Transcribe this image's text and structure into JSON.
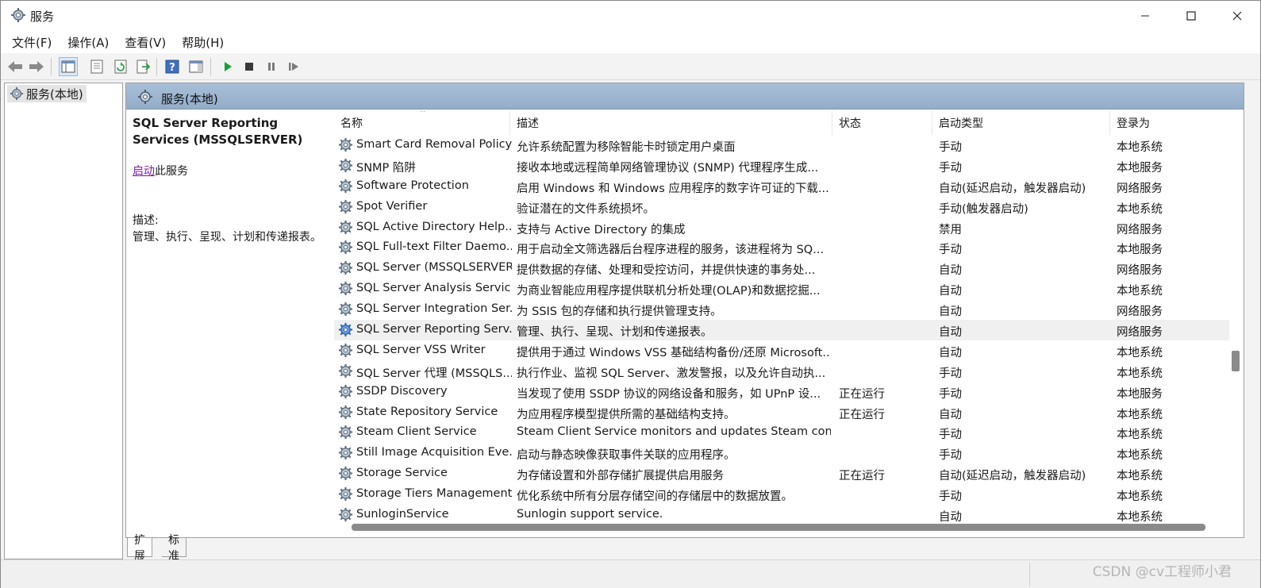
{
  "window": {
    "title": "服务",
    "menu": [
      "文件(F)",
      "操作(A)",
      "查看(V)",
      "帮助(H)"
    ]
  },
  "tree": {
    "root_label": "服务(本地)"
  },
  "main": {
    "header": "服务(本地)",
    "detail": {
      "title": "SQL Server Reporting Services (MSSQLSERVER)",
      "start_link": "启动",
      "start_suffix": "此服务",
      "desc_label": "描述:",
      "desc": "管理、执行、呈现、计划和传递报表。"
    },
    "columns": {
      "name": "名称",
      "desc": "描述",
      "status": "状态",
      "startup": "启动类型",
      "logon": "登录为"
    },
    "rows": [
      {
        "name": "Smart Card Removal Policy",
        "desc": "允许系统配置为移除智能卡时锁定用户桌面",
        "status": "",
        "startup": "手动",
        "logon": "本地系统"
      },
      {
        "name": "SNMP 陷阱",
        "desc": "接收本地或远程简单网络管理协议 (SNMP) 代理程序生成...",
        "status": "",
        "startup": "手动",
        "logon": "本地服务"
      },
      {
        "name": "Software Protection",
        "desc": "启用 Windows 和 Windows 应用程序的数字许可证的下载...",
        "status": "",
        "startup": "自动(延迟启动，触发器启动)",
        "logon": "网络服务"
      },
      {
        "name": "Spot Verifier",
        "desc": "验证潜在的文件系统损坏。",
        "status": "",
        "startup": "手动(触发器启动)",
        "logon": "本地系统"
      },
      {
        "name": "SQL Active Directory Help...",
        "desc": "支持与 Active Directory 的集成",
        "status": "",
        "startup": "禁用",
        "logon": "网络服务"
      },
      {
        "name": "SQL Full-text Filter Daemo...",
        "desc": "用于启动全文筛选器后台程序进程的服务，该进程将为 SQ...",
        "status": "",
        "startup": "手动",
        "logon": "本地服务"
      },
      {
        "name": "SQL Server (MSSQLSERVER)",
        "desc": "提供数据的存储、处理和受控访问，并提供快速的事务处...",
        "status": "",
        "startup": "自动",
        "logon": "网络服务"
      },
      {
        "name": "SQL Server Analysis Servic...",
        "desc": "为商业智能应用程序提供联机分析处理(OLAP)和数据挖掘...",
        "status": "",
        "startup": "自动",
        "logon": "本地系统"
      },
      {
        "name": "SQL Server Integration Ser...",
        "desc": "为 SSIS 包的存储和执行提供管理支持。",
        "status": "",
        "startup": "自动",
        "logon": "网络服务"
      },
      {
        "name": "SQL Server Reporting Serv...",
        "desc": "管理、执行、呈现、计划和传递报表。",
        "status": "",
        "startup": "自动",
        "logon": "网络服务"
      },
      {
        "name": "SQL Server VSS Writer",
        "desc": "提供用于通过 Windows VSS 基础结构备份/还原 Microsoft...",
        "status": "",
        "startup": "自动",
        "logon": "本地系统"
      },
      {
        "name": "SQL Server 代理 (MSSQLS...",
        "desc": "执行作业、监视 SQL Server、激发警报，以及允许自动执...",
        "status": "",
        "startup": "手动",
        "logon": "本地系统"
      },
      {
        "name": "SSDP Discovery",
        "desc": "当发现了使用 SSDP 协议的网络设备和服务，如 UPnP 设...",
        "status": "正在运行",
        "startup": "手动",
        "logon": "本地服务"
      },
      {
        "name": "State Repository Service",
        "desc": "为应用程序模型提供所需的基础结构支持。",
        "status": "正在运行",
        "startup": "自动",
        "logon": "本地系统"
      },
      {
        "name": "Steam Client Service",
        "desc": "Steam Client Service monitors and updates Steam content",
        "status": "",
        "startup": "手动",
        "logon": "本地系统"
      },
      {
        "name": "Still Image Acquisition Eve...",
        "desc": "启动与静态映像获取事件关联的应用程序。",
        "status": "",
        "startup": "手动",
        "logon": "本地系统"
      },
      {
        "name": "Storage Service",
        "desc": "为存储设置和外部存储扩展提供启用服务",
        "status": "正在运行",
        "startup": "自动(延迟启动，触发器启动)",
        "logon": "本地系统"
      },
      {
        "name": "Storage Tiers Management",
        "desc": "优化系统中所有分层存储空间的存储层中的数据放置。",
        "status": "",
        "startup": "手动",
        "logon": "本地系统"
      },
      {
        "name": "SunloginService",
        "desc": "Sunlogin support service.",
        "status": "",
        "startup": "自动",
        "logon": "本地系统"
      }
    ],
    "selected_row": 9
  },
  "tabs": {
    "extended": "扩展",
    "standard": "标准"
  },
  "watermark": "CSDN @cv工程师小君",
  "colors": {
    "header_blue": "#a8bfd8",
    "link_purple": "#7b1fa2",
    "play_green": "#1e9e3a"
  }
}
